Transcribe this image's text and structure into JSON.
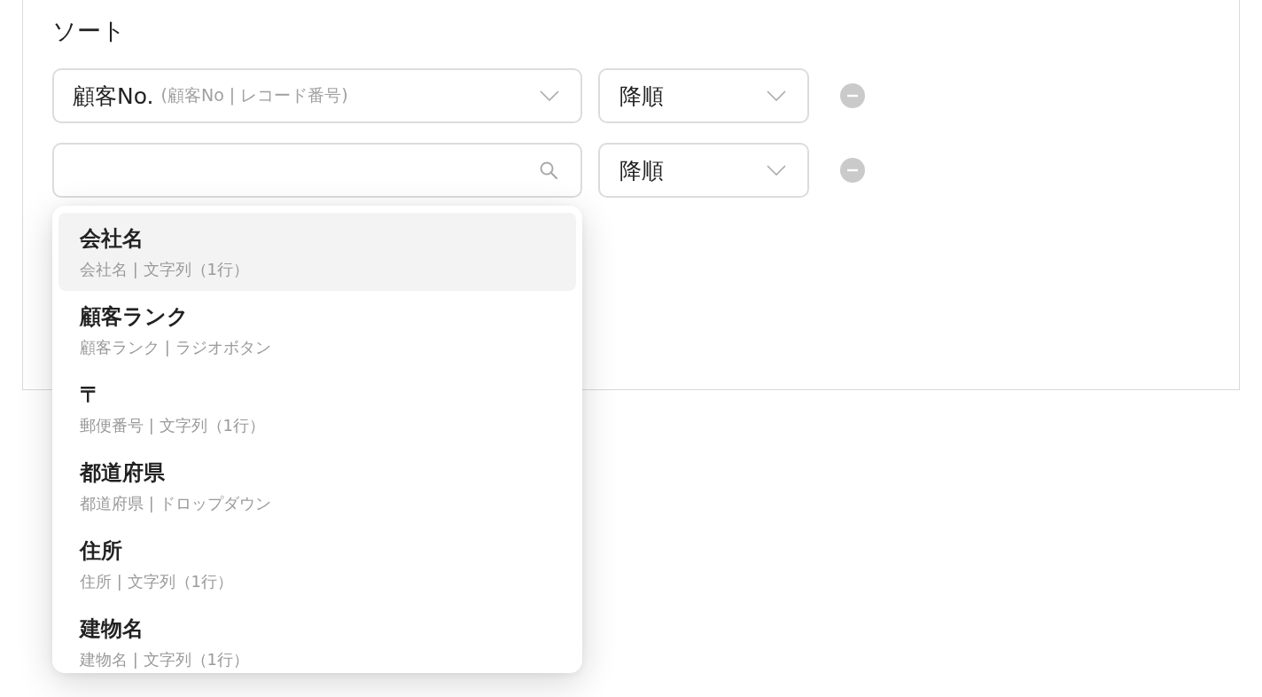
{
  "sort_section": {
    "title": "ソート",
    "rows": [
      {
        "field": {
          "kind": "select",
          "label": "顧客No.",
          "detail": "(顧客No | レコード番号)"
        },
        "order": "降順"
      },
      {
        "field": {
          "kind": "search"
        },
        "order": "降順"
      }
    ]
  },
  "field_dropdown": {
    "items": [
      {
        "title": "会社名",
        "detail": "会社名 | 文字列（1行）",
        "selected": true
      },
      {
        "title": "顧客ランク",
        "detail": "顧客ランク | ラジオボタン",
        "selected": false
      },
      {
        "title": "〒",
        "detail": "郵便番号 | 文字列（1行）",
        "selected": false
      },
      {
        "title": "都道府県",
        "detail": "都道府県 | ドロップダウン",
        "selected": false
      },
      {
        "title": "住所",
        "detail": "住所 | 文字列（1行）",
        "selected": false
      },
      {
        "title": "建物名",
        "detail": "建物名 | 文字列（1行）",
        "selected": false
      }
    ]
  }
}
